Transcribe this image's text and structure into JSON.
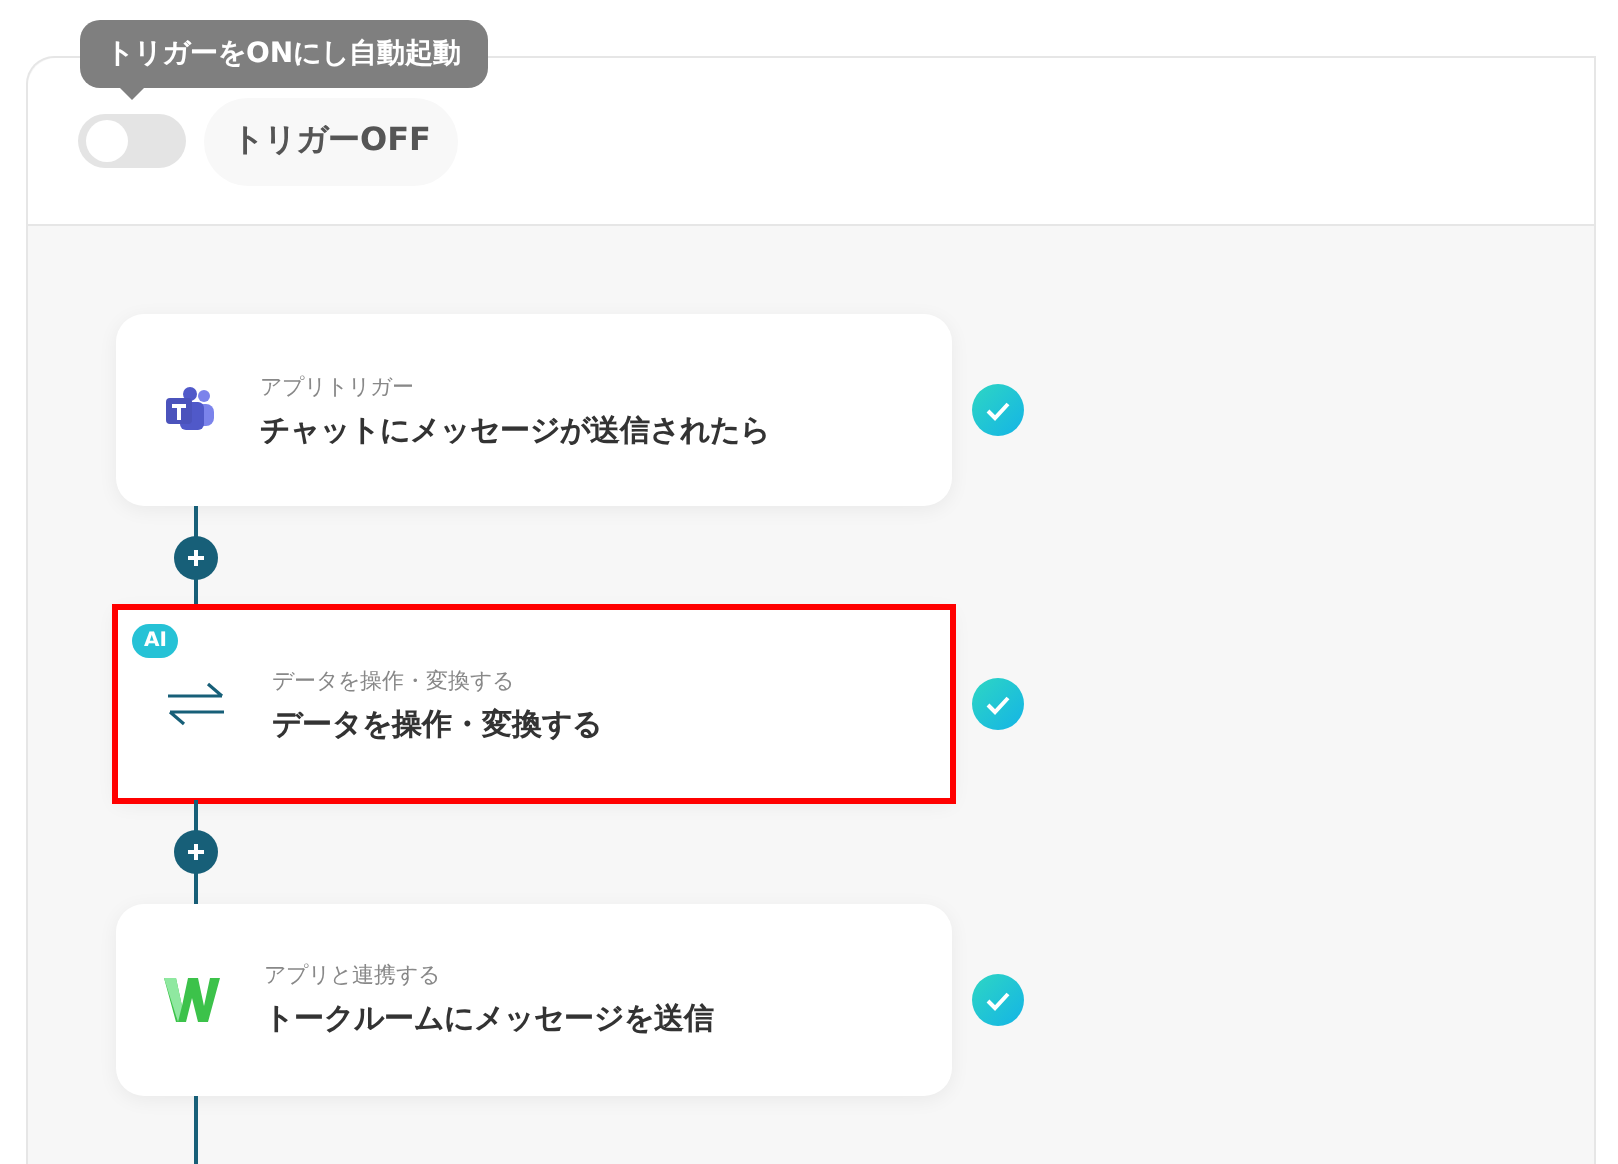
{
  "header": {
    "tooltip": "トリガーをONにし自動起動",
    "trigger_toggle": {
      "on": false
    },
    "trigger_status": "トリガーOFF"
  },
  "steps": [
    {
      "kind": "teams",
      "caption": "アプリトリガー",
      "title": "チャットにメッセージが送信されたら",
      "highlighted": false,
      "done": true
    },
    {
      "kind": "convert",
      "caption": "データを操作・変換する",
      "title": "データを操作・変換する",
      "badge": "AI",
      "highlighted": true,
      "done": true
    },
    {
      "kind": "works",
      "caption": "アプリと連携する",
      "title": "トークルームにメッセージを送信",
      "highlighted": false,
      "done": true
    }
  ]
}
